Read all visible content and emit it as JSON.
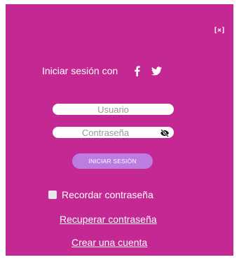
{
  "close_label": "[×]",
  "social": {
    "label": "Iniciar sesión con",
    "icons": [
      "facebook-icon",
      "twitter-icon"
    ]
  },
  "username": {
    "placeholder": "Usuario",
    "value": ""
  },
  "password": {
    "placeholder": "Contraseña",
    "value": "",
    "toggle_icon": "eye-slash-icon"
  },
  "login_button": "INICIAR SESIÓN",
  "remember": {
    "label": "Recordar contraseña",
    "checked": false
  },
  "links": {
    "recover": "Recuperar contraseña",
    "create": "Crear una cuenta"
  },
  "colors": {
    "panel_bg": "#c42892",
    "button_bg": "#bd7ce2",
    "text": "#ffffff"
  }
}
